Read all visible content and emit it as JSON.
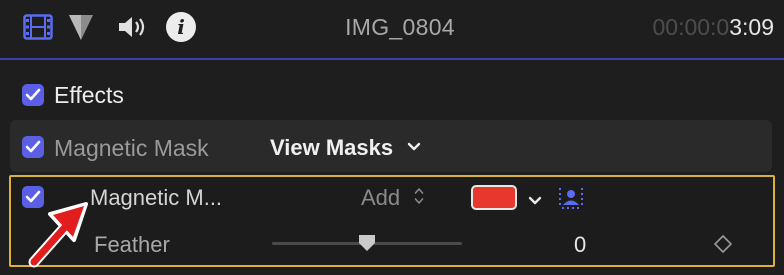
{
  "header": {
    "title": "IMG_0804",
    "timecode_dim": "00:00:0",
    "timecode_active": "3:09",
    "icons": [
      "film-icon",
      "shape-icon",
      "speaker-icon",
      "info-icon"
    ]
  },
  "effects": {
    "label": "Effects",
    "checked": true
  },
  "magnetic_mask": {
    "label": "Magnetic Mask",
    "checked": true,
    "view_masks_label": "View Masks"
  },
  "sub_mask": {
    "label": "Magnetic M...",
    "checked": true,
    "mode_value": "Add",
    "color": "#e8372c"
  },
  "feather": {
    "label": "Feather",
    "value": "0",
    "slider_fraction": 0.5
  },
  "colors": {
    "accent": "#5b5fe6",
    "highlight_border": "#d9b23a",
    "arrow": "#e11d1d"
  }
}
